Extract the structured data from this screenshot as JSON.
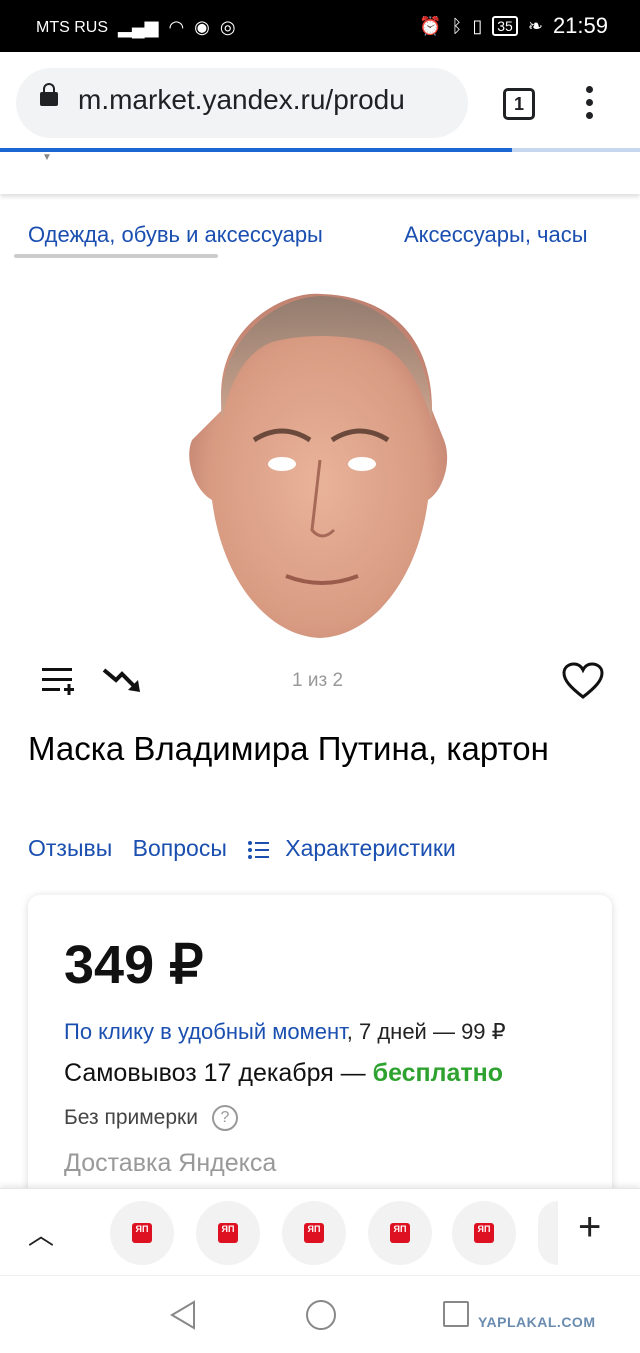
{
  "status_bar": {
    "carrier": "MTS RUS",
    "battery": "35",
    "time": "21:59"
  },
  "browser": {
    "url": "m.market.yandex.ru/produ",
    "tab_count": "1",
    "load_progress_fraction": 0.8
  },
  "breadcrumbs": [
    {
      "label": "Одежда, обувь и аксессуары"
    },
    {
      "label": "Аксессуары, часы"
    }
  ],
  "gallery": {
    "counter": "1 из 2"
  },
  "product": {
    "title": "Маска Владимира Путина, картон"
  },
  "product_tabs": {
    "reviews": "Отзывы",
    "questions": "Вопросы",
    "specs": "Характеристики"
  },
  "offer": {
    "price": "349 ₽",
    "courier_link": "По клику в удобный момент",
    "courier_rest": ", 7 дней — 99 ₽",
    "pickup": "Самовывоз 17 декабря — ",
    "pickup_free": "бесплатно",
    "fitting": "Без примерки",
    "fitting_help": "?",
    "delivery_service": "Доставка Яндекса"
  },
  "tab_strip": {
    "favicon_label": "ЯП"
  },
  "watermark": "YAPLAKAL.COM"
}
